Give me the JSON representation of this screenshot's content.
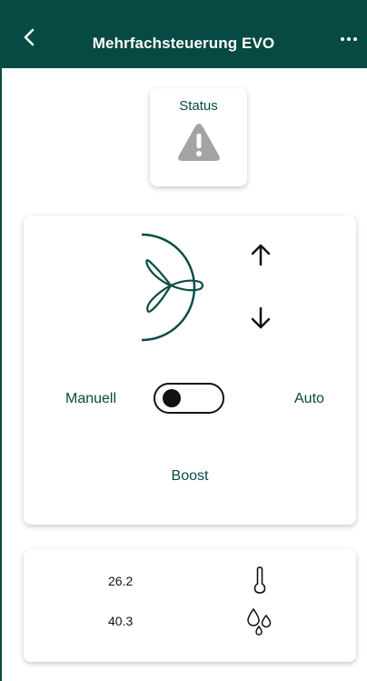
{
  "header": {
    "title": "Mehrfachsteuerung EVO",
    "background": "#064a43"
  },
  "status": {
    "label": "Status",
    "icon": "warning-triangle-icon"
  },
  "fan_control": {
    "fan_icon": "fan-icon",
    "mode_left": "Manuell",
    "mode_right": "Auto",
    "toggle_position": "left",
    "boost_label": "Boost"
  },
  "sensors": {
    "temperature": "26.2",
    "humidity": "40.3",
    "temperature_icon": "thermometer-icon",
    "humidity_icon": "water-drops-icon"
  }
}
